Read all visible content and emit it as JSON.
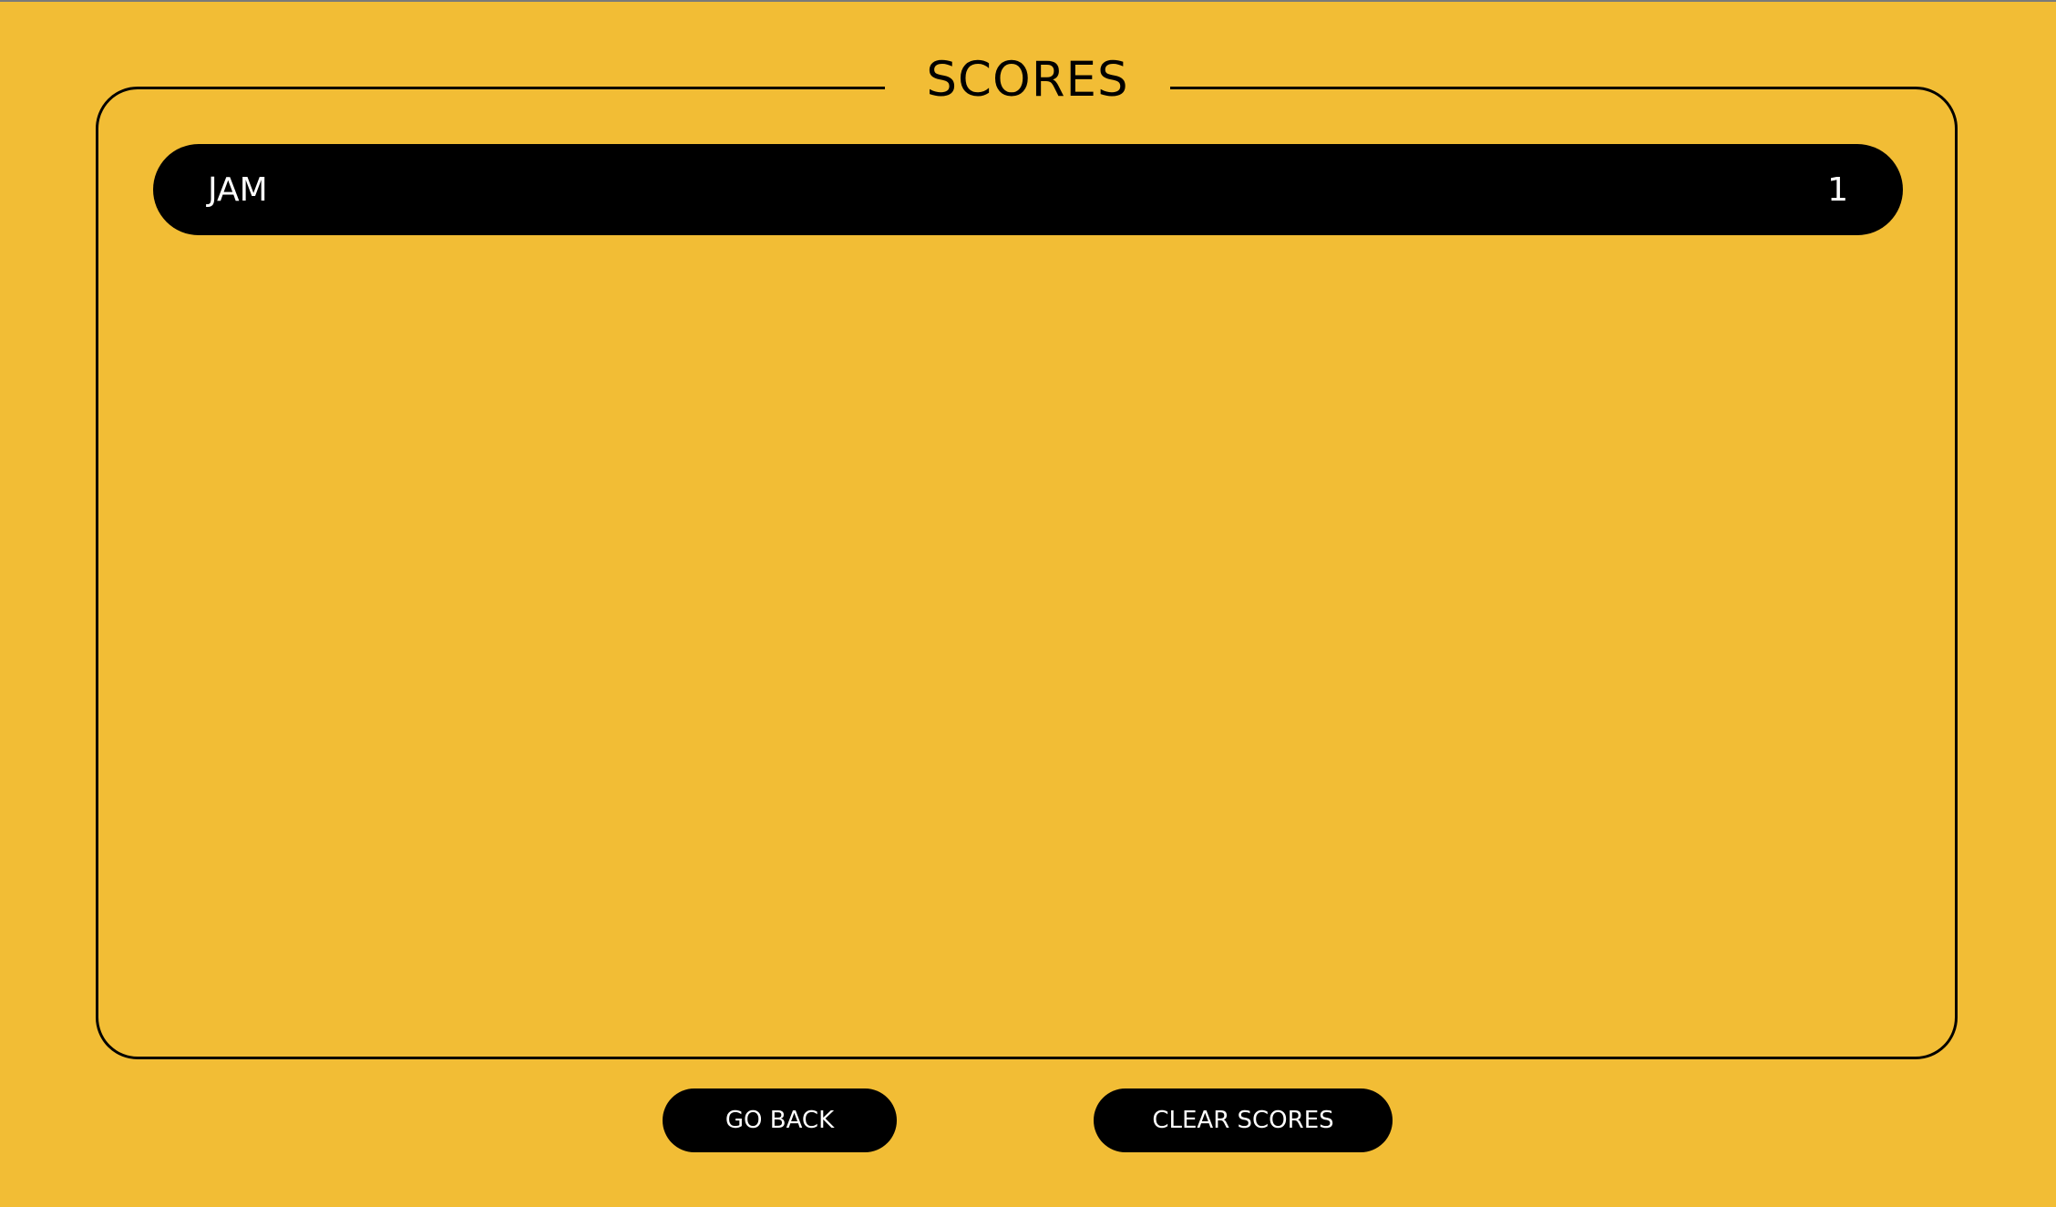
{
  "title": "SCORES",
  "scores": [
    {
      "name": "JAM",
      "score": "1"
    }
  ],
  "buttons": {
    "go_back": "GO BACK",
    "clear_scores": "CLEAR SCORES"
  },
  "colors": {
    "background": "#f2bd35",
    "row": "#000000",
    "text_light": "#ffffff"
  }
}
